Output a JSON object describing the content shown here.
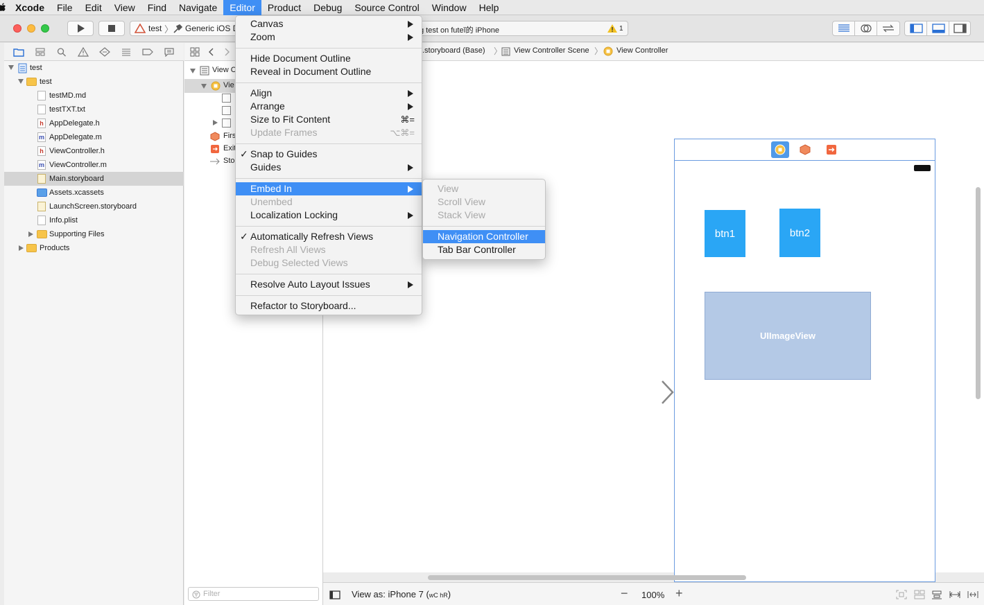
{
  "menubar": {
    "app": "Xcode",
    "items": [
      "File",
      "Edit",
      "View",
      "Find",
      "Navigate",
      "Editor",
      "Product",
      "Debug",
      "Source Control",
      "Window",
      "Help"
    ],
    "active": "Editor"
  },
  "toolbar": {
    "scheme": "test",
    "destination": "Generic iOS D",
    "activity": "g test on futeĭ的 iPhone",
    "warning_count": "1"
  },
  "navigator": {
    "filter_placeholder": "Filter",
    "tree": [
      {
        "label": "test",
        "kind": "project"
      },
      {
        "label": "test",
        "kind": "folder"
      },
      {
        "label": "testMD.md",
        "kind": "file"
      },
      {
        "label": "testTXT.txt",
        "kind": "file"
      },
      {
        "label": "AppDelegate.h",
        "kind": "h"
      },
      {
        "label": "AppDelegate.m",
        "kind": "m"
      },
      {
        "label": "ViewController.h",
        "kind": "h"
      },
      {
        "label": "ViewController.m",
        "kind": "m"
      },
      {
        "label": "Main.storyboard",
        "kind": "storyboard",
        "selected": true
      },
      {
        "label": "Assets.xcassets",
        "kind": "assets"
      },
      {
        "label": "LaunchScreen.storyboard",
        "kind": "storyboard"
      },
      {
        "label": "Info.plist",
        "kind": "file"
      },
      {
        "label": "Supporting Files",
        "kind": "folder"
      },
      {
        "label": "Products",
        "kind": "folder"
      }
    ]
  },
  "outline": {
    "items": [
      "View C",
      "Vie",
      "Firs",
      "Exit",
      "Sto"
    ]
  },
  "jumpbar": {
    "crumbs": [
      ".storyboard (Base)",
      "View Controller Scene",
      "View Controller"
    ]
  },
  "editor_menu": {
    "items": [
      {
        "label": "Canvas",
        "submenu": true
      },
      {
        "label": "Zoom",
        "submenu": true
      },
      {
        "label": "Hide Document Outline"
      },
      {
        "label": "Reveal in Document Outline"
      },
      {
        "label": "Align",
        "submenu": true
      },
      {
        "label": "Arrange",
        "submenu": true
      },
      {
        "label": "Size to Fit Content",
        "shortcut": "⌘="
      },
      {
        "label": "Update Frames",
        "shortcut": "⌥⌘=",
        "disabled": true
      },
      {
        "label": "Snap to Guides",
        "checked": true
      },
      {
        "label": "Guides",
        "submenu": true
      },
      {
        "label": "Embed In",
        "submenu": true,
        "highlighted": true
      },
      {
        "label": "Unembed",
        "disabled": true
      },
      {
        "label": "Localization Locking",
        "submenu": true
      },
      {
        "label": "Automatically Refresh Views",
        "checked": true
      },
      {
        "label": "Refresh All Views",
        "disabled": true
      },
      {
        "label": "Debug Selected Views",
        "disabled": true
      },
      {
        "label": "Resolve Auto Layout Issues",
        "submenu": true
      },
      {
        "label": "Refactor to Storyboard..."
      }
    ]
  },
  "embed_submenu": {
    "items": [
      {
        "label": "View",
        "disabled": true
      },
      {
        "label": "Scroll View",
        "disabled": true
      },
      {
        "label": "Stack View",
        "disabled": true
      },
      {
        "label": "Navigation Controller",
        "highlighted": true
      },
      {
        "label": "Tab Bar Controller"
      }
    ]
  },
  "canvas": {
    "btn1": "btn1",
    "btn2": "btn2",
    "image_view": "UIImageView"
  },
  "bottombar": {
    "view_as": "View as: iPhone 7 (",
    "size_class": "wC hR",
    "view_as_close": ")",
    "zoom": "100%"
  },
  "colors": {
    "accent": "#3f8ff5",
    "button_blue": "#2aa6f5",
    "image_view_fill": "#b4c9e6"
  }
}
